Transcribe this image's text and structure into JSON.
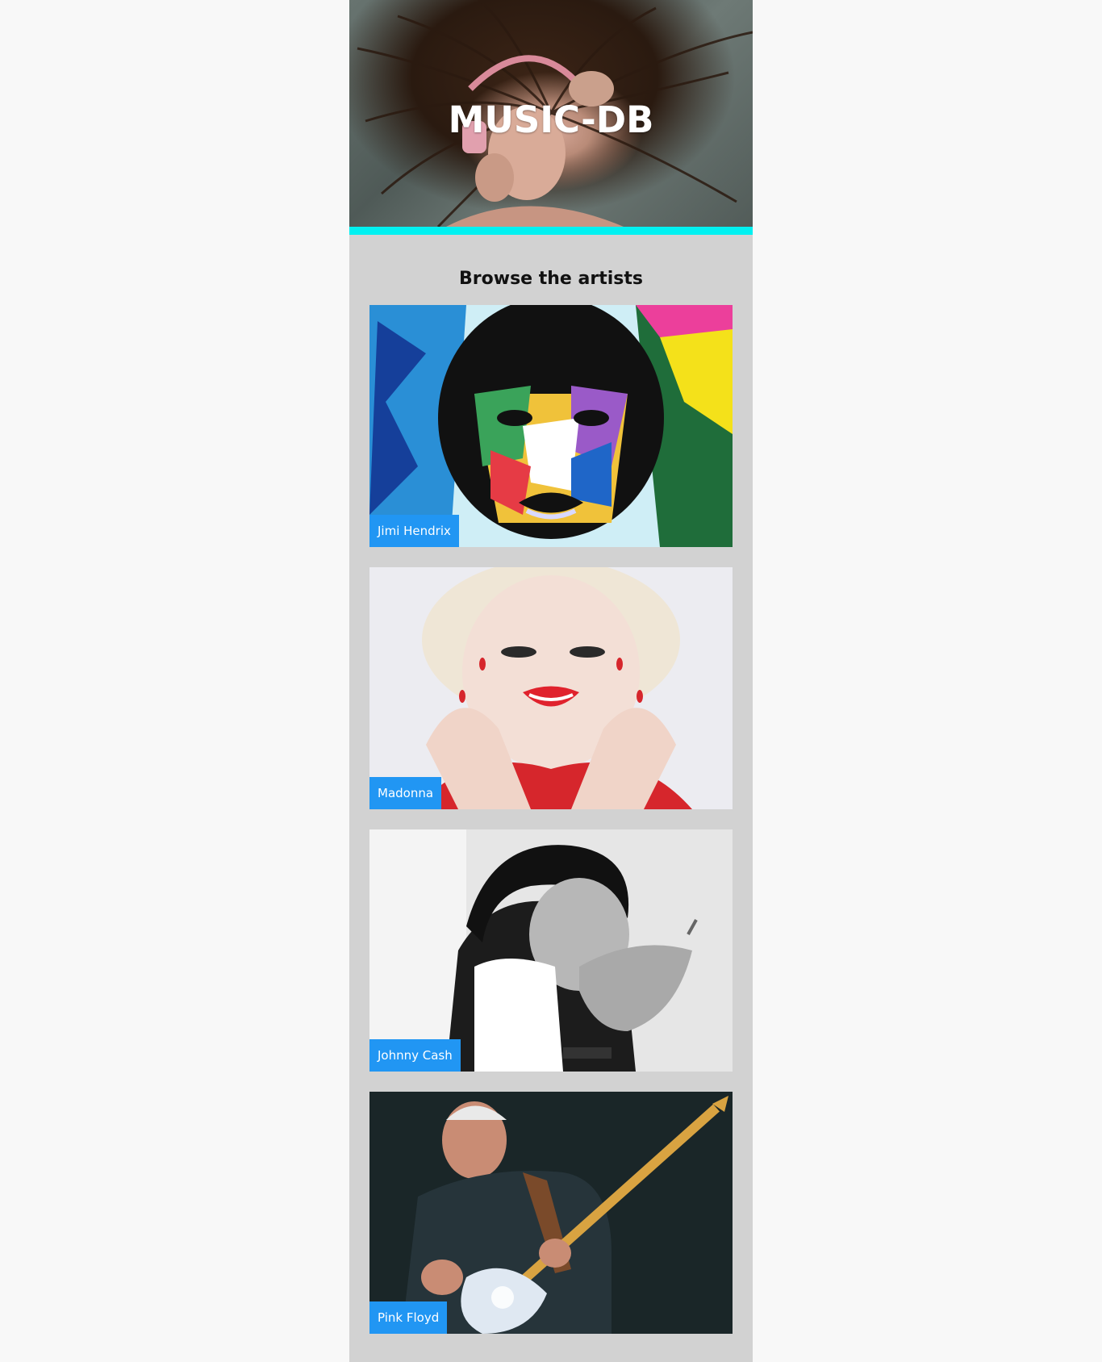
{
  "hero": {
    "title": "MUSIC-DB",
    "accent_color": "#00f1f1"
  },
  "browse": {
    "heading": "Browse the artists"
  },
  "artists": [
    {
      "name": "Jimi Hendrix"
    },
    {
      "name": "Madonna"
    },
    {
      "name": "Johnny Cash"
    },
    {
      "name": "Pink Floyd"
    }
  ],
  "colors": {
    "label_background": "#2196f3",
    "page_background": "#d2d2d2"
  }
}
